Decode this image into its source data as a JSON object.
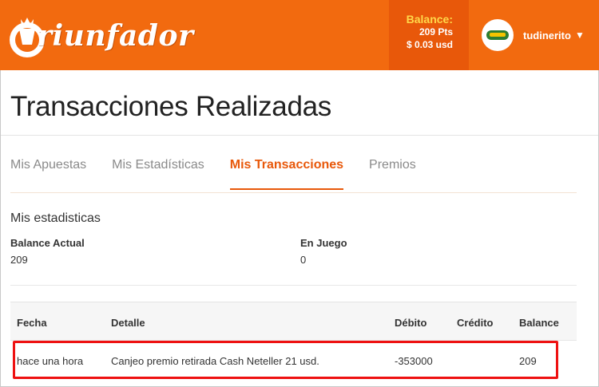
{
  "brand": {
    "logo_text": "riunfador"
  },
  "header": {
    "balance_label": "Balance:",
    "balance_points": "209 Pts",
    "balance_usd": "$ 0.03 usd",
    "username": "tudinerito",
    "caret": "▼"
  },
  "page": {
    "title": "Transacciones Realizadas"
  },
  "tabs": [
    {
      "label": "Mis Apuestas",
      "active": false
    },
    {
      "label": "Mis Estadísticas",
      "active": false
    },
    {
      "label": "Mis Transacciones",
      "active": true
    },
    {
      "label": "Premios",
      "active": false
    }
  ],
  "stats": {
    "title": "Mis estadisticas",
    "items": [
      {
        "label": "Balance Actual",
        "value": "209"
      },
      {
        "label": "En Juego",
        "value": "0"
      }
    ]
  },
  "table": {
    "headers": [
      "Fecha",
      "Detalle",
      "Débito",
      "Crédito",
      "Balance"
    ],
    "rows": [
      [
        "hace una hora",
        "Canjeo premio retirada Cash Neteller 21 usd.",
        "-353000",
        "",
        "209"
      ]
    ]
  },
  "colors": {
    "brand_orange": "#f26a0f",
    "accent": "#e8580a",
    "highlight": "#ee1111"
  }
}
